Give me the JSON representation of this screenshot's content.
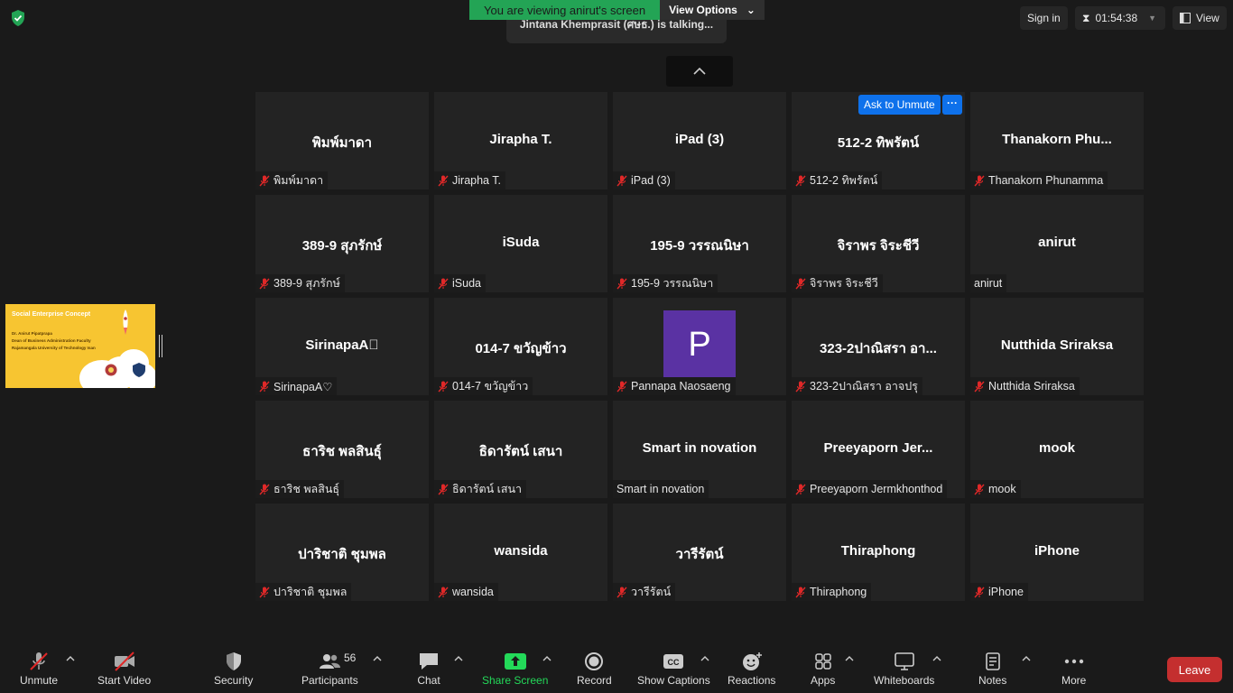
{
  "top": {
    "viewing_banner": "You are viewing anirut's screen",
    "view_options": "View Options",
    "talking": "Jintana Khemprasit (ศษธ.) is talking...",
    "sign_in": "Sign in",
    "timer": "01:54:38",
    "view": "View"
  },
  "share_thumb": {
    "title": "Social Enterprise Concept",
    "line1": "Dr. Anirut Pipatprapa",
    "line2": "Dean of Business Administration Faculty",
    "line3": "Rajamangala University of Technology Isan"
  },
  "ask_unmute": "Ask to Unmute",
  "more": "···",
  "tiles": [
    {
      "name": "พิมพ์มาดา",
      "label": "พิมพ์มาดา",
      "muted": true
    },
    {
      "name": "Jirapha T.",
      "label": "Jirapha T.",
      "muted": true
    },
    {
      "name": "iPad (3)",
      "label": "iPad (3)",
      "muted": true
    },
    {
      "name": "512-2 ทิพรัตน์",
      "label": "512-2 ทิพรัตน์",
      "muted": true
    },
    {
      "name": "Thanakorn  Phu...",
      "label": "Thanakorn Phunamma",
      "muted": true
    },
    {
      "name": "389-9 สุภรักษ์",
      "label": "389-9 สุภรักษ์",
      "muted": true
    },
    {
      "name": "iSuda",
      "label": "iSuda",
      "muted": true
    },
    {
      "name": "195-9 วรรณนิษา",
      "label": "195-9 วรรณนิษา",
      "muted": true
    },
    {
      "name": "จิราพร จิระชีวี",
      "label": "จิราพร จิระชีวี",
      "muted": true
    },
    {
      "name": "anirut",
      "label": "anirut",
      "muted": false
    },
    {
      "name": "SirinapaA􀀀",
      "label": "SirinapaA♡",
      "muted": true
    },
    {
      "name": "014-7 ขวัญข้าว",
      "label": "014-7 ขวัญข้าว",
      "muted": true
    },
    {
      "name": "",
      "label": "Pannapa Naosaeng",
      "muted": true,
      "avatar": "P"
    },
    {
      "name": "323-2ปาณิสรา อา...",
      "label": "323-2ปาณิสรา อาจปรุ",
      "muted": true
    },
    {
      "name": "Nutthida Sriraksa",
      "label": "Nutthida Sriraksa",
      "muted": true
    },
    {
      "name": "ธาริช พลสินธุ์",
      "label": "ธาริช พลสินธุ์",
      "muted": true
    },
    {
      "name": "ธิดารัตน์ เสนา",
      "label": "ธิดารัตน์ เสนา",
      "muted": true
    },
    {
      "name": "Smart in novation",
      "label": "Smart in novation",
      "muted": false
    },
    {
      "name": "Preeyaporn  Jer...",
      "label": "Preeyaporn Jermkhonthod",
      "muted": true
    },
    {
      "name": "mook",
      "label": "mook",
      "muted": true
    },
    {
      "name": "ปาริชาติ ชุมพล",
      "label": "ปาริชาติ ชุมพล",
      "muted": true
    },
    {
      "name": "wansida",
      "label": "wansida",
      "muted": true
    },
    {
      "name": "วารีรัตน์",
      "label": "วารีรัตน์",
      "muted": true
    },
    {
      "name": "Thiraphong",
      "label": "Thiraphong",
      "muted": true
    },
    {
      "name": "iPhone",
      "label": "iPhone",
      "muted": true
    }
  ],
  "toolbar": {
    "unmute": "Unmute",
    "start_video": "Start Video",
    "security": "Security",
    "participants": "Participants",
    "participants_count": "56",
    "chat": "Chat",
    "share_screen": "Share Screen",
    "record": "Record",
    "show_captions": "Show Captions",
    "reactions": "Reactions",
    "apps": "Apps",
    "whiteboards": "Whiteboards",
    "notes": "Notes",
    "more": "More",
    "leave": "Leave"
  },
  "colors": {
    "banner_green": "#23a455",
    "share_green": "#23d959",
    "accent_blue": "#0e71eb",
    "leave_red": "#c42f2f",
    "avatar_purple": "#5a32a3"
  }
}
